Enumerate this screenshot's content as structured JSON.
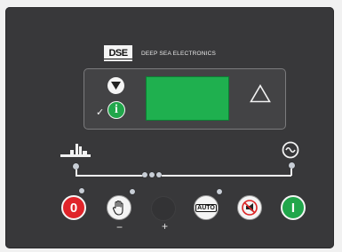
{
  "brand": {
    "logo_text": "DSE",
    "name": "DEEP SEA ELECTRONICS"
  },
  "display": {
    "lcd_color": "#1fb04f"
  },
  "buttons": {
    "stop": {
      "label": "0",
      "color": "#e0242a"
    },
    "manual": {
      "icon": "hand-icon"
    },
    "auto": {
      "label": "AUTO"
    },
    "mute": {
      "icon": "mute-horn-icon"
    },
    "start": {
      "label": "I",
      "color": "#21a64b"
    },
    "info": {
      "label": "i"
    }
  },
  "labels": {
    "minus": "−",
    "plus": "+"
  },
  "colors": {
    "panel": "#38383a",
    "led": "#c8ced6"
  }
}
